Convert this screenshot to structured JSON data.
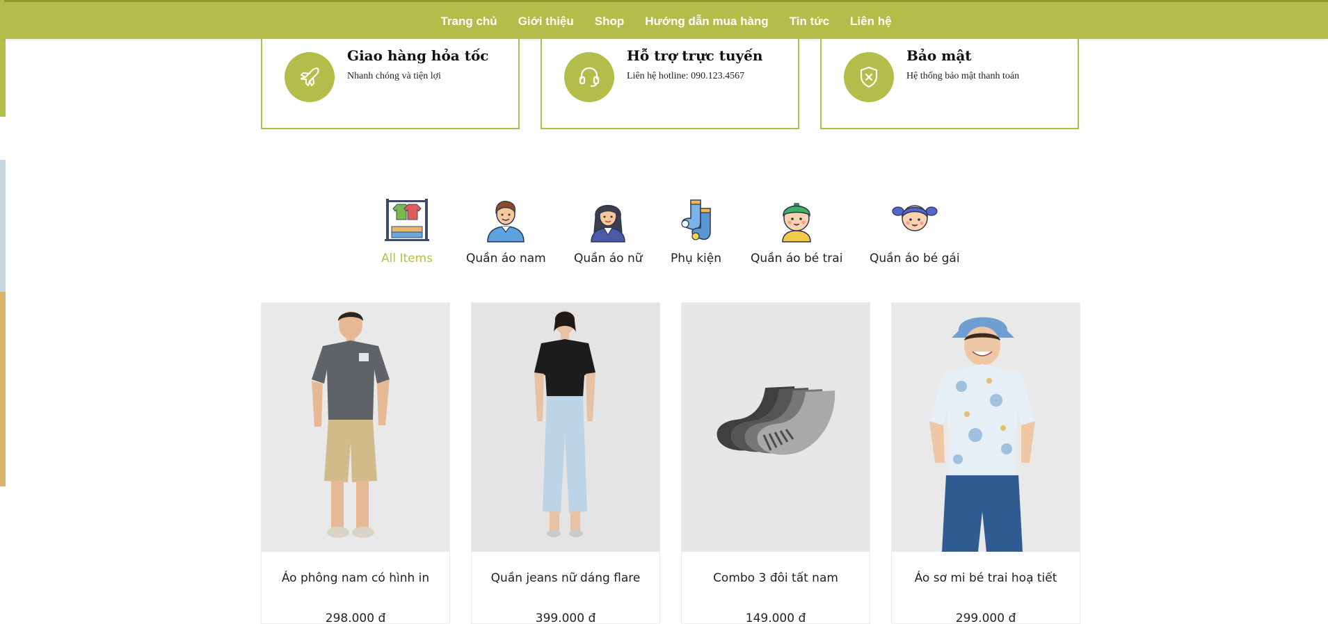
{
  "nav": {
    "items": [
      {
        "label": "Trang chủ"
      },
      {
        "label": "Giới thiệu"
      },
      {
        "label": "Shop"
      },
      {
        "label": "Hướng dẫn mua hàng"
      },
      {
        "label": "Tin tức"
      },
      {
        "label": "Liên hệ"
      }
    ]
  },
  "services": [
    {
      "title": "Giao hàng hỏa tốc",
      "desc": "Nhanh chóng và tiện lợi",
      "icon": "airplane-icon"
    },
    {
      "title": "Hỗ trợ trực tuyến",
      "desc": "Liên hệ hotline: 090.123.4567",
      "icon": "headset-icon"
    },
    {
      "title": "Bảo mật",
      "desc": "Hệ thống bảo mật thanh toán",
      "icon": "shield-icon"
    }
  ],
  "categories": [
    {
      "label": "All Items",
      "icon": "clothes-rack-icon",
      "active": true
    },
    {
      "label": "Quần áo nam",
      "icon": "man-avatar-icon"
    },
    {
      "label": "Quần áo nữ",
      "icon": "woman-avatar-icon"
    },
    {
      "label": "Phụ kiện",
      "icon": "socks-icon"
    },
    {
      "label": "Quần áo bé trai",
      "icon": "boy-avatar-icon"
    },
    {
      "label": "Quần áo bé gái",
      "icon": "girl-avatar-icon"
    }
  ],
  "products": [
    {
      "name": "Áo phông nam có hình in",
      "price": "298.000 đ"
    },
    {
      "name": "Quần jeans nữ dáng flare",
      "price": "399.000 đ"
    },
    {
      "name": "Combo 3 đôi tất nam",
      "price": "149.000 đ"
    },
    {
      "name": "Áo sơ mi bé trai hoạ tiết",
      "price": "299.000 đ"
    }
  ],
  "colors": {
    "accent": "#b5bd4a",
    "text": "#222222"
  }
}
